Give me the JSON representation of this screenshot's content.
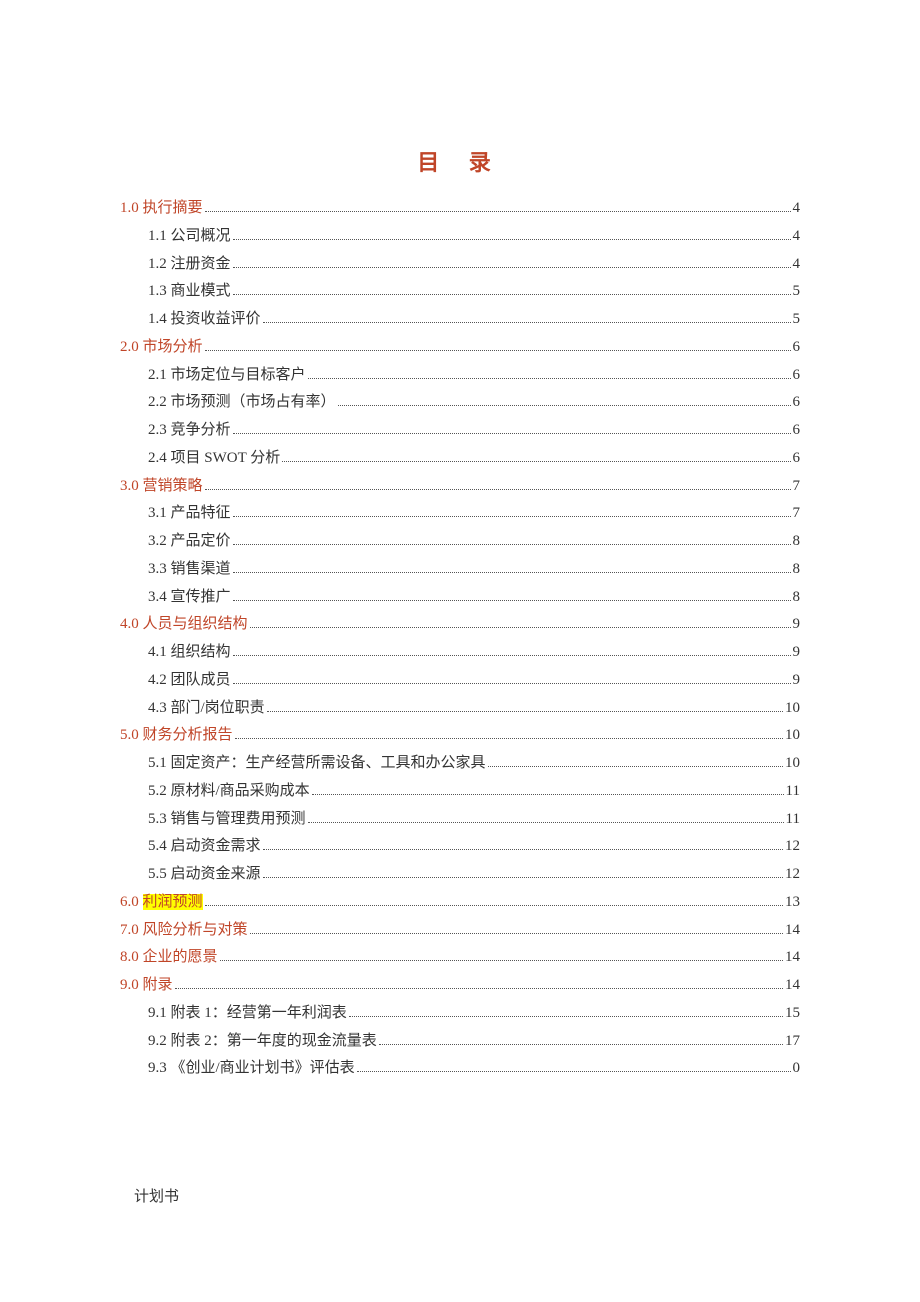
{
  "title": "目 录",
  "footer": "计划书",
  "entries": [
    {
      "level": 1,
      "label": "1.0 执行摘要",
      "page": "4",
      "section": true
    },
    {
      "level": 2,
      "label": "1.1 公司概况",
      "page": "4"
    },
    {
      "level": 2,
      "label": "1.2 注册资金",
      "page": "4"
    },
    {
      "level": 2,
      "label": "1.3 商业模式",
      "page": "5"
    },
    {
      "level": 2,
      "label": "1.4 投资收益评价",
      "page": "5"
    },
    {
      "level": 1,
      "label": "2.0 市场分析",
      "page": "6",
      "section": true
    },
    {
      "level": 2,
      "label": "2.1 市场定位与目标客户  ",
      "page": "6"
    },
    {
      "level": 2,
      "label": "2.2 市场预测（市场占有率）  ",
      "page": "6"
    },
    {
      "level": 2,
      "label": "2.3 竞争分析  ",
      "page": "6"
    },
    {
      "level": 2,
      "label": "2.4 项目 SWOT 分析",
      "page": "6"
    },
    {
      "level": 1,
      "label": "3.0  营销策略",
      "page": "7",
      "section": true
    },
    {
      "level": 2,
      "label": "3.1 产品特征  ",
      "page": "7"
    },
    {
      "level": 2,
      "label": "3.2 产品定价",
      "page": "8"
    },
    {
      "level": 2,
      "label": "3.3 销售渠道 ",
      "page": "8"
    },
    {
      "level": 2,
      "label": "3.4 宣传推广",
      "page": "8"
    },
    {
      "level": 1,
      "label": "4.0 人员与组织结构 ",
      "page": "9",
      "section": true
    },
    {
      "level": 2,
      "label": "4.1 组织结构",
      "page": "9"
    },
    {
      "level": 2,
      "label": "4.2 团队成员 ",
      "page": "9"
    },
    {
      "level": 2,
      "label": "4.3 部门/岗位职责 ",
      "page": "10"
    },
    {
      "level": 1,
      "label": "5.0  财务分析报告 ",
      "page": "10",
      "section": true
    },
    {
      "level": 2,
      "label": "5.1 固定资产：生产经营所需设备、工具和办公家具",
      "page": "10"
    },
    {
      "level": 2,
      "label": "5.2 原材料/商品采购成本",
      "page": "11"
    },
    {
      "level": 2,
      "label": "5.3 销售与管理费用预测",
      "page": "11"
    },
    {
      "level": 2,
      "label": "5.4 启动资金需求 ",
      "page": "12"
    },
    {
      "level": 2,
      "label": "5.5 启动资金来源 ",
      "page": "12"
    },
    {
      "level": 1,
      "label_prefix": "6.0 ",
      "label_highlight": "利润预测",
      "label_suffix": "  ",
      "page": "13",
      "section": true,
      "has_highlight": true
    },
    {
      "level": 1,
      "label": "7.0 风险分析与对策",
      "page": "14",
      "section": true
    },
    {
      "level": 1,
      "label": "8.0 企业的愿景",
      "page": "14",
      "section": true
    },
    {
      "level": 1,
      "label": "9.0 附录",
      "page": "14",
      "section": true
    },
    {
      "level": 2,
      "label": "9.1 附表 1：经营第一年利润表  ",
      "page": "15"
    },
    {
      "level": 2,
      "label": "9.2 附表 2：第一年度的现金流量表",
      "page": "17"
    },
    {
      "level": 2,
      "label": "9.3 《创业/商业计划书》评估表",
      "page": "0"
    }
  ]
}
